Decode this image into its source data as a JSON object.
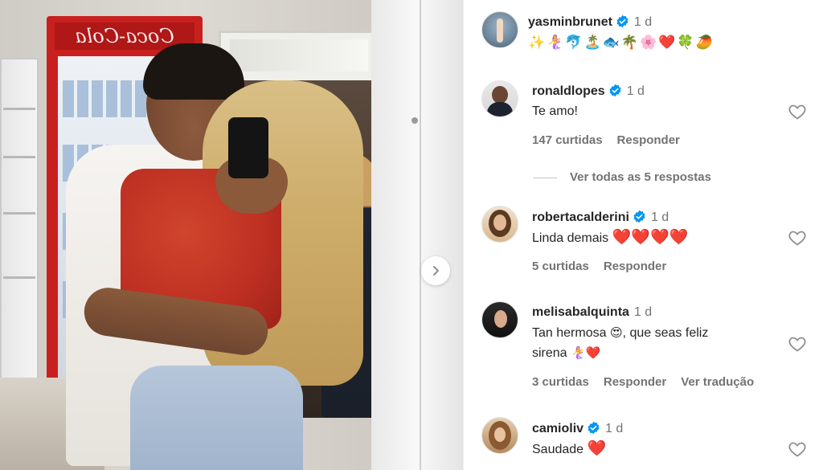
{
  "post": {
    "author": "yasminbrunet",
    "time": "1 d",
    "caption_emojis": "✨🧜‍♀️🐬🏝️🐟🌴🌸❤️🍀🥭",
    "photo_sign_text": "Coca-Cola"
  },
  "comments": [
    {
      "user": "ronaldlopes",
      "verified": true,
      "time": "1 d",
      "text": "Te amo!",
      "likes": "147 curtidas",
      "reply": "Responder",
      "view_replies": "Ver todas as 5 respostas"
    },
    {
      "user": "robertacalderini",
      "verified": true,
      "time": "1 d",
      "text": "Linda demais",
      "hearts": "❤️❤️❤️❤️",
      "likes": "5 curtidas",
      "reply": "Responder"
    },
    {
      "user": "melisabalquinta",
      "verified": false,
      "time": "1 d",
      "text_line1": "Tan hermosa",
      "text_line1_emoji": "😍",
      "text_line1_rest": ", que seas feliz",
      "text_line2": "sirena",
      "text_line2_emoji": "🧜‍♀️❤️",
      "likes": "3 curtidas",
      "reply": "Responder",
      "translate": "Ver tradução"
    },
    {
      "user": "camioliv",
      "verified": true,
      "time": "1 d",
      "text": "Saudade",
      "hearts": "❤️"
    }
  ],
  "colors": {
    "verified_blue": "#0095f6",
    "text_primary": "#262626",
    "text_secondary": "#737373",
    "heart_red": "#e0142a"
  }
}
